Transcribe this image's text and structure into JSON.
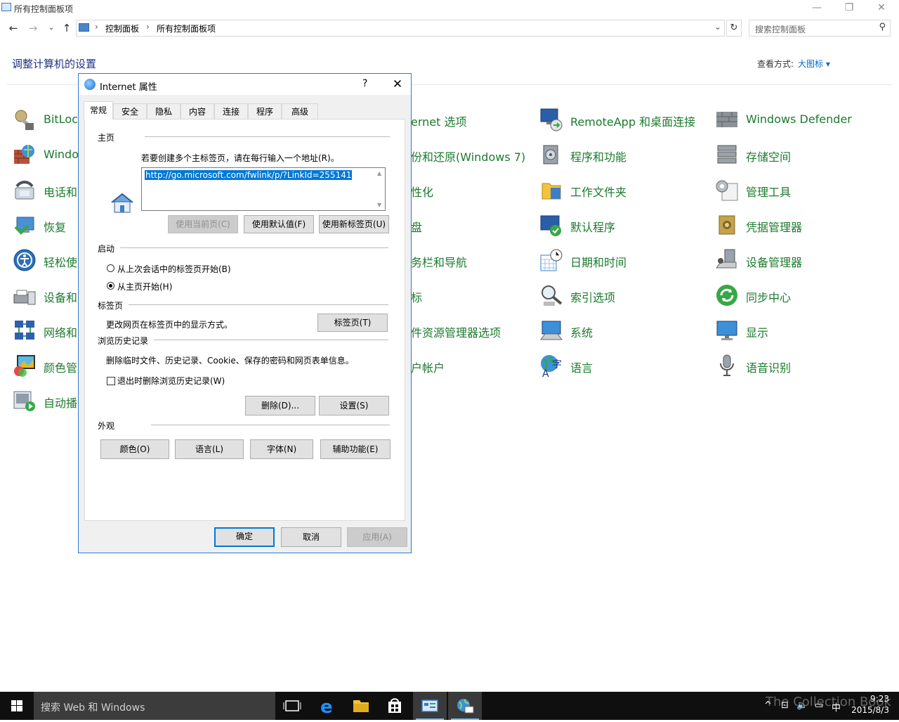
{
  "window": {
    "title": "所有控制面板项",
    "breadcrumb": [
      "控制面板",
      "所有控制面板项"
    ],
    "search_placeholder": "搜索控制面板",
    "header": "调整计算机的设置",
    "view_by_label": "查看方式:",
    "view_by_value": "大图标 ▾"
  },
  "control_panel_items": [
    {
      "label": "BitLock",
      "icon": "bitlocker-key-icon"
    },
    {
      "label": "Windo",
      "icon": "windows-firewall-icon"
    },
    {
      "label": "电话和",
      "icon": "phone-modem-icon"
    },
    {
      "label": "恢复",
      "icon": "recovery-icon"
    },
    {
      "label": "轻松使",
      "icon": "ease-of-access-icon"
    },
    {
      "label": "设备和",
      "icon": "devices-printers-icon"
    },
    {
      "label": "网络和",
      "icon": "network-sharing-icon"
    },
    {
      "label": "颜色管",
      "icon": "color-management-icon"
    },
    {
      "label": "自动播",
      "icon": "autoplay-icon"
    },
    {
      "label": "ernet 选项",
      "icon": "internet-options-icon"
    },
    {
      "label": "份和还原(Windows 7)",
      "icon": "backup-restore-icon"
    },
    {
      "label": "性化",
      "icon": "personalization-icon"
    },
    {
      "label": "盘",
      "icon": "disk-icon"
    },
    {
      "label": "务栏和导航",
      "icon": "taskbar-navigation-icon"
    },
    {
      "label": "标",
      "icon": "mouse-icon"
    },
    {
      "label": "件资源管理器选项",
      "icon": "file-explorer-options-icon"
    },
    {
      "label": "户帐户",
      "icon": "user-accounts-icon"
    },
    {
      "label": "RemoteApp 和桌面连接",
      "icon": "remoteapp-icon"
    },
    {
      "label": "程序和功能",
      "icon": "programs-features-icon"
    },
    {
      "label": "工作文件夹",
      "icon": "work-folders-icon"
    },
    {
      "label": "默认程序",
      "icon": "default-programs-icon"
    },
    {
      "label": "日期和时间",
      "icon": "date-time-icon"
    },
    {
      "label": "索引选项",
      "icon": "indexing-options-icon"
    },
    {
      "label": "系统",
      "icon": "system-icon"
    },
    {
      "label": "语言",
      "icon": "language-icon"
    },
    {
      "label": "Windows Defender",
      "icon": "windows-defender-icon"
    },
    {
      "label": "存储空间",
      "icon": "storage-spaces-icon"
    },
    {
      "label": "管理工具",
      "icon": "administrative-tools-icon"
    },
    {
      "label": "凭据管理器",
      "icon": "credential-manager-icon"
    },
    {
      "label": "设备管理器",
      "icon": "device-manager-icon"
    },
    {
      "label": "同步中心",
      "icon": "sync-center-icon"
    },
    {
      "label": "显示",
      "icon": "display-icon"
    },
    {
      "label": "语音识别",
      "icon": "speech-recognition-icon"
    }
  ],
  "dialog": {
    "title": "Internet 属性",
    "help": "?",
    "close": "✕",
    "tabs": [
      "常规",
      "安全",
      "隐私",
      "内容",
      "连接",
      "程序",
      "高级"
    ],
    "homepage": {
      "group": "主页",
      "instruction": "若要创建多个主标签页，请在每行输入一个地址(R)。",
      "url": "http://go.microsoft.com/fwlink/p/?LinkId=255141",
      "use_current": "使用当前页(C)",
      "use_default": "使用默认值(F)",
      "use_new_tab": "使用新标签页(U)"
    },
    "startup": {
      "group": "启动",
      "option_last_session": "从上次会话中的标签页开始(B)",
      "option_home": "从主页开始(H)",
      "selected": "option_home"
    },
    "tabs_section": {
      "group": "标签页",
      "text": "更改网页在标签页中的显示方式。",
      "button": "标签页(T)"
    },
    "history": {
      "group": "浏览历史记录",
      "text": "删除临时文件、历史记录、Cookie、保存的密码和网页表单信息。",
      "checkbox": "退出时删除浏览历史记录(W)",
      "checked": false,
      "delete": "删除(D)...",
      "settings": "设置(S)"
    },
    "appearance": {
      "group": "外观",
      "colors": "颜色(O)",
      "languages": "语言(L)",
      "fonts": "字体(N)",
      "accessibility": "辅助功能(E)"
    },
    "ok": "确定",
    "cancel": "取消",
    "apply": "应用(A)"
  },
  "taskbar": {
    "search_placeholder": "搜索 Web 和 Windows",
    "time": "9:23",
    "date": "2015/8/3",
    "ime": "中",
    "watermark": "The Collection Book"
  },
  "colors": {
    "link_green": "#1c7a2e",
    "header_blue": "#1e3287",
    "accent": "#0078d7"
  }
}
